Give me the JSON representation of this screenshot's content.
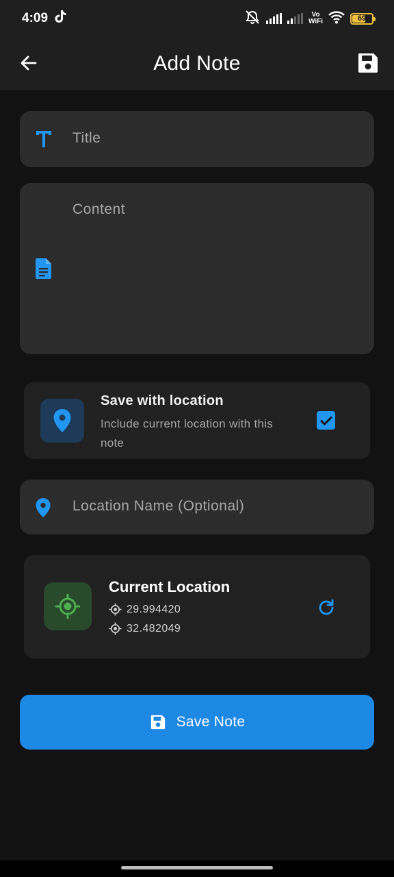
{
  "status_bar": {
    "time": "4:09",
    "network_label_top": "Vo",
    "network_label_bottom": "WiFi",
    "battery_level": "69",
    "battery_fraction": 0.69
  },
  "app_bar": {
    "title": "Add Note",
    "back_icon": "arrow-left-icon",
    "save_icon": "floppy-disk-icon"
  },
  "form": {
    "title_placeholder": "Title",
    "content_placeholder": "Content",
    "location_name_placeholder": "Location Name (Optional)"
  },
  "save_with_location": {
    "title": "Save with location",
    "description": "Include current location with this note",
    "checked": true
  },
  "current_location": {
    "title": "Current Location",
    "latitude": "29.994420",
    "longitude": "32.482049"
  },
  "save_button": {
    "label": "Save Note"
  },
  "colors": {
    "accent": "#1e88e5",
    "checkbox": "#2196f3",
    "gps_green": "#4caf50",
    "background": "#121212",
    "surface": "#2c2c2c",
    "card": "#212121"
  }
}
